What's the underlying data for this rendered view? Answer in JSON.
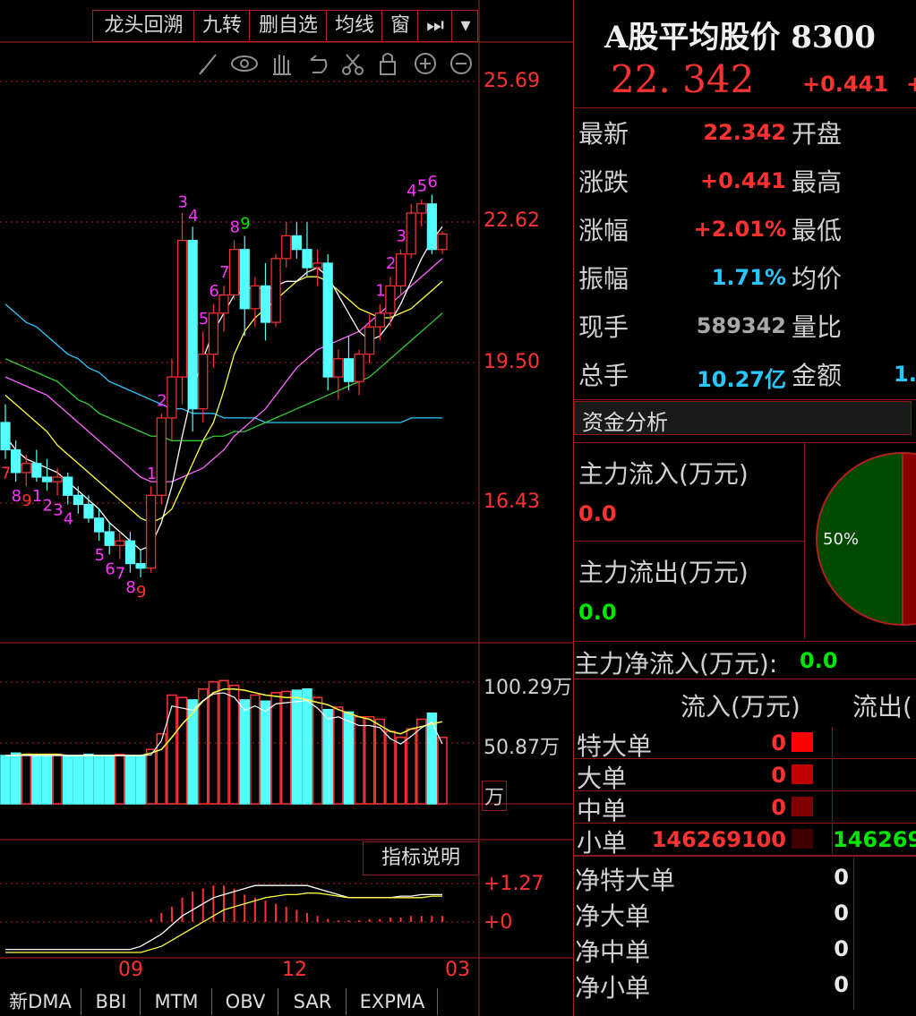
{
  "toolbar": {
    "buttons": [
      "龙头回溯",
      "九转",
      "删自选",
      "均线",
      "窗"
    ],
    "next_icon": "⏭",
    "dropdown_icon": "▾"
  },
  "icons": [
    "pen-icon",
    "eye-icon",
    "hand-icon",
    "undo-icon",
    "scissors-icon",
    "lock-icon",
    "zoom-in-icon",
    "zoom-out-icon"
  ],
  "header": {
    "title": "A股平均股价 8300",
    "price": "22. 342",
    "change": "+0.441",
    "change2": "+"
  },
  "quote": {
    "rows": [
      {
        "label": "最新",
        "value": "22.342",
        "label2": "开盘"
      },
      {
        "label": "涨跌",
        "value": "+0.441",
        "label2": "最高"
      },
      {
        "label": "涨幅",
        "value": "+2.01%",
        "label2": "最低"
      },
      {
        "label": "振幅",
        "value": "1.71%",
        "label2": "均价"
      },
      {
        "label": "现手",
        "value": "589342",
        "label2": "量比"
      },
      {
        "label": "总手",
        "value": "10.27亿",
        "label2": "金额",
        "extra": "1."
      }
    ]
  },
  "fund": {
    "section_title": "资金分析",
    "inflow_label": "主力流入(万元)",
    "inflow_value": "0.0",
    "outflow_label": "主力流出(万元)",
    "outflow_value": "0.0",
    "pie_label": "50%",
    "net_label": "主力净流入(万元):",
    "net_value": "0.0",
    "col_in": "流入(万元)",
    "col_out": "流出(",
    "orders": [
      {
        "label": "特大单",
        "in": "0",
        "out": ""
      },
      {
        "label": "大单",
        "in": "0",
        "out": ""
      },
      {
        "label": "中单",
        "in": "0",
        "out": ""
      },
      {
        "label": "小单",
        "in": "146269100",
        "out": "146269"
      }
    ],
    "net_orders": [
      {
        "label": "净特大单",
        "value": "0"
      },
      {
        "label": "净大单",
        "value": "0"
      },
      {
        "label": "净中单",
        "value": "0"
      },
      {
        "label": "净小单",
        "value": "0"
      }
    ],
    "colors": {
      "pie_green": "#004400",
      "pie_red": "#8a0000",
      "sq1": "#ff0000",
      "sq2": "#c00000",
      "sq3": "#800000",
      "sq4": "#400000"
    }
  },
  "chart_data": {
    "type": "candlestick",
    "price_axis": [
      "25.69",
      "22.62",
      "19.50",
      "16.43"
    ],
    "volume_axis": [
      "100.29万",
      "50.87万",
      "万"
    ],
    "indicator_axis": [
      "+1.27",
      "+0"
    ],
    "indicator_btn": "指标说明",
    "x_labels": [
      "09",
      "12",
      "03"
    ],
    "td_counts_upper": [
      "1",
      "2",
      "3",
      "4",
      "5",
      "6",
      "7",
      "8",
      "9",
      "1",
      "2",
      "3",
      "4",
      "5",
      "6"
    ],
    "td_counts_lower": [
      "7",
      "8",
      "9",
      "1",
      "2",
      "3",
      "4",
      "5",
      "6",
      "7",
      "8",
      "9"
    ],
    "tabs": [
      "新DMA",
      "BBI",
      "MTM",
      "OBV",
      "SAR",
      "EXPMA"
    ],
    "candles": [
      [
        18.2,
        18.6,
        17.4,
        17.6
      ],
      [
        17.6,
        17.8,
        16.9,
        17.1
      ],
      [
        17.1,
        17.5,
        16.8,
        17.3
      ],
      [
        17.3,
        17.6,
        16.9,
        17.0
      ],
      [
        17.0,
        17.4,
        16.7,
        16.9
      ],
      [
        16.9,
        17.2,
        16.6,
        17.0
      ],
      [
        17.0,
        17.1,
        16.4,
        16.6
      ],
      [
        16.6,
        16.8,
        16.2,
        16.4
      ],
      [
        16.4,
        16.6,
        16.0,
        16.1
      ],
      [
        16.1,
        16.3,
        15.6,
        15.8
      ],
      [
        15.8,
        16.0,
        15.3,
        15.5
      ],
      [
        15.5,
        15.8,
        15.2,
        15.6
      ],
      [
        15.6,
        15.8,
        14.9,
        15.1
      ],
      [
        15.1,
        15.4,
        14.8,
        15.0
      ],
      [
        15.0,
        16.8,
        14.9,
        16.6
      ],
      [
        16.6,
        18.4,
        16.4,
        18.3
      ],
      [
        18.3,
        19.6,
        17.8,
        19.2
      ],
      [
        19.2,
        22.8,
        18.6,
        22.2
      ],
      [
        22.2,
        22.5,
        18.0,
        18.5
      ],
      [
        18.5,
        20.2,
        18.2,
        19.7
      ],
      [
        19.7,
        20.8,
        19.4,
        20.6
      ],
      [
        20.6,
        21.2,
        20.2,
        21.0
      ],
      [
        21.0,
        22.2,
        20.9,
        22.0
      ],
      [
        22.0,
        22.3,
        20.1,
        20.7
      ],
      [
        20.7,
        21.4,
        20.3,
        21.2
      ],
      [
        21.2,
        21.7,
        20.0,
        20.4
      ],
      [
        20.4,
        21.9,
        20.3,
        21.8
      ],
      [
        21.8,
        22.6,
        21.6,
        22.3
      ],
      [
        22.3,
        22.6,
        21.8,
        22.0
      ],
      [
        22.0,
        22.6,
        21.4,
        21.6
      ],
      [
        21.6,
        22.0,
        21.2,
        21.7
      ],
      [
        21.7,
        21.9,
        18.9,
        19.2
      ],
      [
        19.2,
        19.8,
        18.7,
        19.6
      ],
      [
        19.6,
        20.1,
        18.9,
        19.1
      ],
      [
        19.1,
        19.8,
        18.8,
        19.7
      ],
      [
        19.7,
        20.6,
        19.5,
        20.3
      ],
      [
        20.3,
        20.8,
        20.0,
        20.6
      ],
      [
        20.6,
        21.4,
        20.3,
        21.2
      ],
      [
        21.2,
        22.0,
        21.0,
        21.9
      ],
      [
        21.9,
        23.0,
        21.8,
        22.8
      ],
      [
        22.8,
        23.1,
        22.5,
        23.0
      ],
      [
        23.0,
        23.2,
        21.9,
        22.0
      ],
      [
        22.0,
        22.4,
        21.9,
        22.34
      ]
    ],
    "ma5": [
      17.9,
      17.6,
      17.4,
      17.3,
      17.2,
      17.1,
      16.9,
      16.7,
      16.5,
      16.3,
      16.0,
      15.8,
      15.6,
      15.4,
      15.5,
      16.0,
      16.8,
      17.9,
      18.9,
      19.6,
      20.2,
      20.6,
      21.0,
      21.1,
      21.2,
      21.1,
      21.2,
      21.3,
      21.3,
      21.5,
      21.6,
      21.4,
      21.0,
      20.6,
      20.2,
      20.0,
      20.1,
      20.4,
      20.8,
      21.3,
      21.8,
      22.2,
      22.5
    ],
    "ma10": [
      18.8,
      18.6,
      18.4,
      18.2,
      18.0,
      17.7,
      17.5,
      17.3,
      17.1,
      16.9,
      16.7,
      16.5,
      16.3,
      16.1,
      16.0,
      16.1,
      16.3,
      16.8,
      17.3,
      17.8,
      18.2,
      18.9,
      19.7,
      20.2,
      20.5,
      20.7,
      20.9,
      21.1,
      21.3,
      21.4,
      21.4,
      21.3,
      21.1,
      20.9,
      20.7,
      20.6,
      20.5,
      20.5,
      20.6,
      20.7,
      20.9,
      21.1,
      21.3
    ],
    "ma20": [
      19.2,
      19.1,
      19.0,
      18.9,
      18.8,
      18.6,
      18.4,
      18.2,
      18.0,
      17.8,
      17.6,
      17.4,
      17.2,
      17.0,
      16.9,
      16.9,
      16.9,
      17.0,
      17.1,
      17.2,
      17.4,
      17.6,
      17.9,
      18.1,
      18.3,
      18.5,
      18.8,
      19.1,
      19.4,
      19.6,
      19.8,
      19.9,
      20.0,
      20.1,
      20.2,
      20.4,
      20.6,
      20.8,
      21.0,
      21.2,
      21.4,
      21.6,
      21.8
    ],
    "ma30": [
      19.6,
      19.5,
      19.4,
      19.3,
      19.2,
      19.1,
      18.9,
      18.7,
      18.6,
      18.4,
      18.3,
      18.2,
      18.1,
      18.0,
      17.9,
      17.9,
      17.8,
      17.8,
      17.8,
      17.8,
      17.9,
      17.9,
      18.0,
      18.0,
      18.1,
      18.2,
      18.3,
      18.4,
      18.5,
      18.6,
      18.7,
      18.8,
      18.9,
      19.0,
      19.1,
      19.2,
      19.4,
      19.6,
      19.8,
      20.0,
      20.2,
      20.4,
      20.6
    ],
    "ma60": [
      20.8,
      20.6,
      20.4,
      20.3,
      20.1,
      19.9,
      19.7,
      19.6,
      19.4,
      19.3,
      19.1,
      19.0,
      18.9,
      18.8,
      18.7,
      18.6,
      18.5,
      18.5,
      18.4,
      18.4,
      18.4,
      18.3,
      18.3,
      18.3,
      18.3,
      18.2,
      18.2,
      18.2,
      18.2,
      18.2,
      18.2,
      18.2,
      18.2,
      18.2,
      18.2,
      18.2,
      18.2,
      18.2,
      18.2,
      18.3,
      18.3,
      18.3,
      18.3
    ],
    "volume": [
      40,
      42,
      41,
      40,
      40,
      41,
      40,
      40,
      41,
      40,
      40,
      41,
      40,
      40,
      45,
      58,
      90,
      88,
      86,
      95,
      101,
      102,
      98,
      86,
      90,
      85,
      92,
      93,
      94,
      95,
      88,
      78,
      80,
      76,
      72,
      72,
      70,
      60,
      55,
      62,
      70,
      75,
      55
    ],
    "vol_ma": [
      40,
      40,
      41,
      41,
      41,
      41,
      40,
      40,
      40,
      40,
      40,
      40,
      40,
      40,
      42,
      45,
      55,
      66,
      75,
      85,
      92,
      95,
      95,
      94,
      92,
      90,
      89,
      88,
      88,
      86,
      84,
      82,
      78,
      75,
      72,
      70,
      65,
      60,
      58,
      62,
      64,
      66,
      68
    ],
    "macd_hist": [
      0,
      0,
      0,
      0,
      0,
      0,
      0,
      0,
      0,
      0,
      0,
      0,
      0,
      0,
      0.1,
      0.3,
      0.5,
      0.8,
      1.0,
      1.1,
      1.2,
      1.2,
      1.1,
      0.9,
      0.8,
      0.7,
      0.6,
      0.5,
      0.4,
      0.3,
      0.2,
      0.1,
      0.05,
      0.05,
      0.05,
      0.1,
      0.1,
      0.15,
      0.15,
      0.2,
      0.2,
      0.2,
      0.2
    ],
    "dif": [
      -0.9,
      -0.9,
      -0.9,
      -0.9,
      -0.9,
      -0.9,
      -0.9,
      -0.9,
      -0.9,
      -0.9,
      -0.9,
      -0.9,
      -0.9,
      -0.8,
      -0.6,
      -0.4,
      -0.1,
      0.2,
      0.4,
      0.6,
      0.8,
      0.9,
      1.0,
      1.1,
      1.2,
      1.2,
      1.2,
      1.2,
      1.2,
      1.2,
      1.1,
      1.0,
      0.9,
      0.8,
      0.8,
      0.8,
      0.8,
      0.8,
      0.85,
      0.85,
      0.9,
      0.9,
      0.9
    ],
    "dea": [
      -1.0,
      -1.0,
      -1.0,
      -1.0,
      -1.0,
      -1.0,
      -1.0,
      -1.0,
      -1.0,
      -1.0,
      -1.0,
      -1.0,
      -1.0,
      -1.0,
      -0.9,
      -0.8,
      -0.6,
      -0.4,
      -0.2,
      0.0,
      0.2,
      0.4,
      0.5,
      0.6,
      0.7,
      0.8,
      0.85,
      0.9,
      0.9,
      0.95,
      0.95,
      0.9,
      0.85,
      0.8,
      0.8,
      0.8,
      0.8,
      0.8,
      0.8,
      0.8,
      0.8,
      0.85,
      0.85
    ]
  }
}
